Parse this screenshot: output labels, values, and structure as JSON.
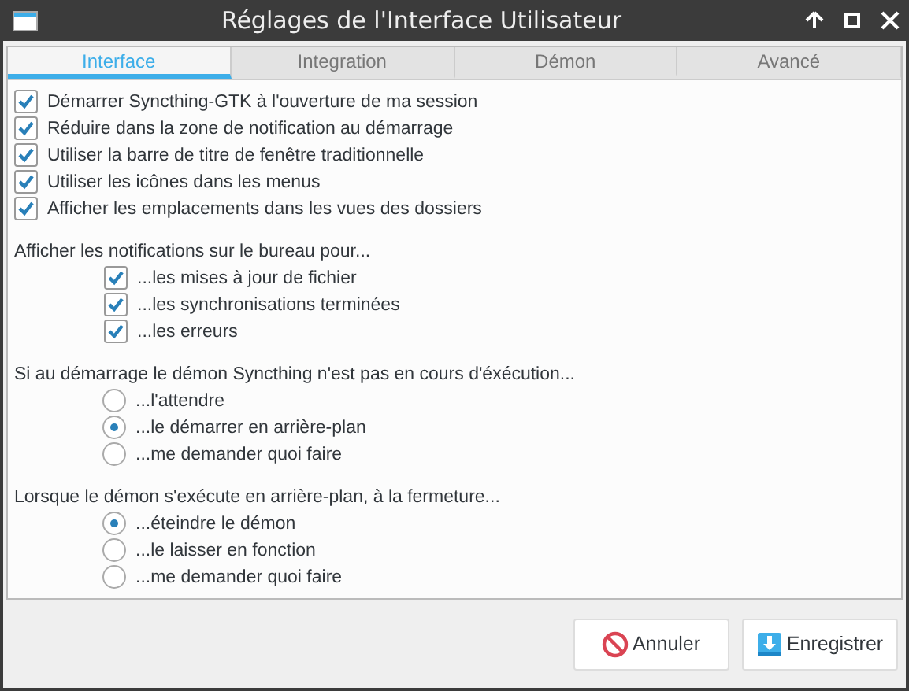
{
  "window": {
    "title": "Réglages de l'Interface Utilisateur"
  },
  "tabs": [
    {
      "label": "Interface",
      "selected": true
    },
    {
      "label": "Integration",
      "selected": false
    },
    {
      "label": "Démon",
      "selected": false
    },
    {
      "label": "Avancé",
      "selected": false
    }
  ],
  "options": [
    {
      "label": "Démarrer Syncthing-GTK à l'ouverture de ma session",
      "checked": true
    },
    {
      "label": "Réduire dans la zone de notification au démarrage",
      "checked": true
    },
    {
      "label": "Utiliser la barre de titre de fenêtre traditionnelle",
      "checked": true
    },
    {
      "label": "Utiliser les icônes dans les menus",
      "checked": true
    },
    {
      "label": "Afficher les emplacements dans les vues des dossiers",
      "checked": true
    }
  ],
  "groups": [
    {
      "heading": "Afficher les notifications sur le bureau pour...",
      "items": [
        {
          "kind": "checkbox",
          "label": "...les mises à jour de fichier",
          "checked": true
        },
        {
          "kind": "checkbox",
          "label": "...les synchronisations terminées",
          "checked": true
        },
        {
          "kind": "checkbox",
          "label": "...les erreurs",
          "checked": true
        }
      ]
    },
    {
      "heading": "Si au démarrage le démon Syncthing n'est pas en cours d'éxécution...",
      "items": [
        {
          "kind": "radio",
          "label": "...l'attendre",
          "selected": false
        },
        {
          "kind": "radio",
          "label": "...le démarrer en arrière-plan",
          "selected": true
        },
        {
          "kind": "radio",
          "label": "...me demander quoi faire",
          "selected": false
        }
      ]
    },
    {
      "heading": "Lorsque le démon s'exécute en arrière-plan, à la fermeture...",
      "items": [
        {
          "kind": "radio",
          "label": "...éteindre le démon",
          "selected": true
        },
        {
          "kind": "radio",
          "label": "...le laisser en fonction",
          "selected": false
        },
        {
          "kind": "radio",
          "label": "...me demander quoi faire",
          "selected": false
        }
      ]
    }
  ],
  "buttons": [
    {
      "kind": "cancel",
      "label": "Annuler"
    },
    {
      "kind": "save",
      "label": "Enregistrer"
    }
  ]
}
